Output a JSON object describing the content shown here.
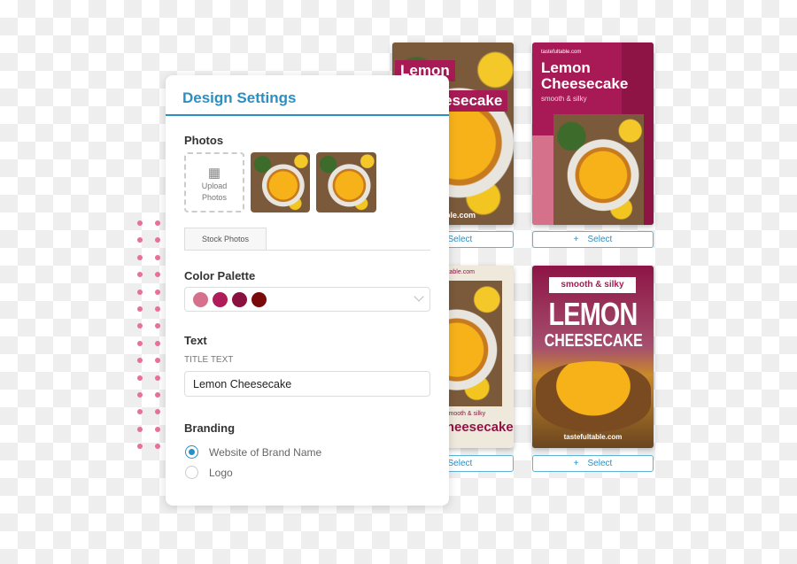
{
  "panel": {
    "title": "Design Settings",
    "photos": {
      "label": "Photos",
      "upload": "Upload Photos",
      "stock_tab": "Stock Photos"
    },
    "palette": {
      "label": "Color Palette",
      "colors": [
        "#d6718c",
        "#b01c5a",
        "#8a1040",
        "#7a0a0a"
      ]
    },
    "text": {
      "label": "Text",
      "field_label": "TITLE TEXT",
      "title_value": "Lemon Cheesecake"
    },
    "branding": {
      "label": "Branding",
      "options": [
        {
          "label": "Website of Brand Name",
          "selected": true
        },
        {
          "label": "Logo",
          "selected": false
        }
      ]
    }
  },
  "templates": [
    {
      "title1": "Lemon",
      "title2": "Cheesecake",
      "site": "tastefultable.com",
      "select": "Select"
    },
    {
      "site": "tastefultable.com",
      "title1": "Lemon",
      "title2": "Cheesecake",
      "sub": "smooth & silky",
      "select": "Select"
    },
    {
      "site": "tastefultable.com",
      "sub": "smooth & silky",
      "title2": "Cheesecake",
      "select": "Select"
    },
    {
      "sub": "smooth & silky",
      "title1": "LEMON",
      "title2": "CHEESECAKE",
      "site": "tastefultable.com",
      "select": "Select"
    }
  ],
  "accent": "#2a8fc4"
}
